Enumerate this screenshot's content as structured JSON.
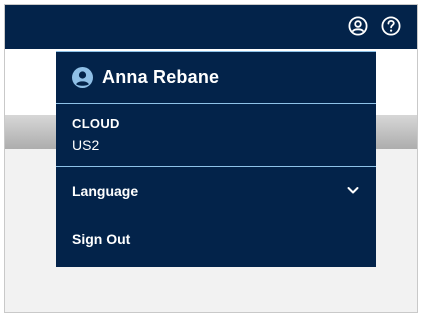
{
  "header": {
    "user_icon": "user-circle-icon",
    "help_icon": "help-circle-icon"
  },
  "menu": {
    "user_name": "Anna Rebane",
    "avatar_icon": "user-avatar-icon",
    "cloud_label": "CLOUD",
    "cloud_value": "US2",
    "language_label": "Language",
    "language_icon": "chevron-down-icon",
    "sign_out_label": "Sign Out"
  },
  "colors": {
    "navy": "#03234a",
    "divider": "#8ec2e8",
    "avatar": "#8fbfe6"
  }
}
